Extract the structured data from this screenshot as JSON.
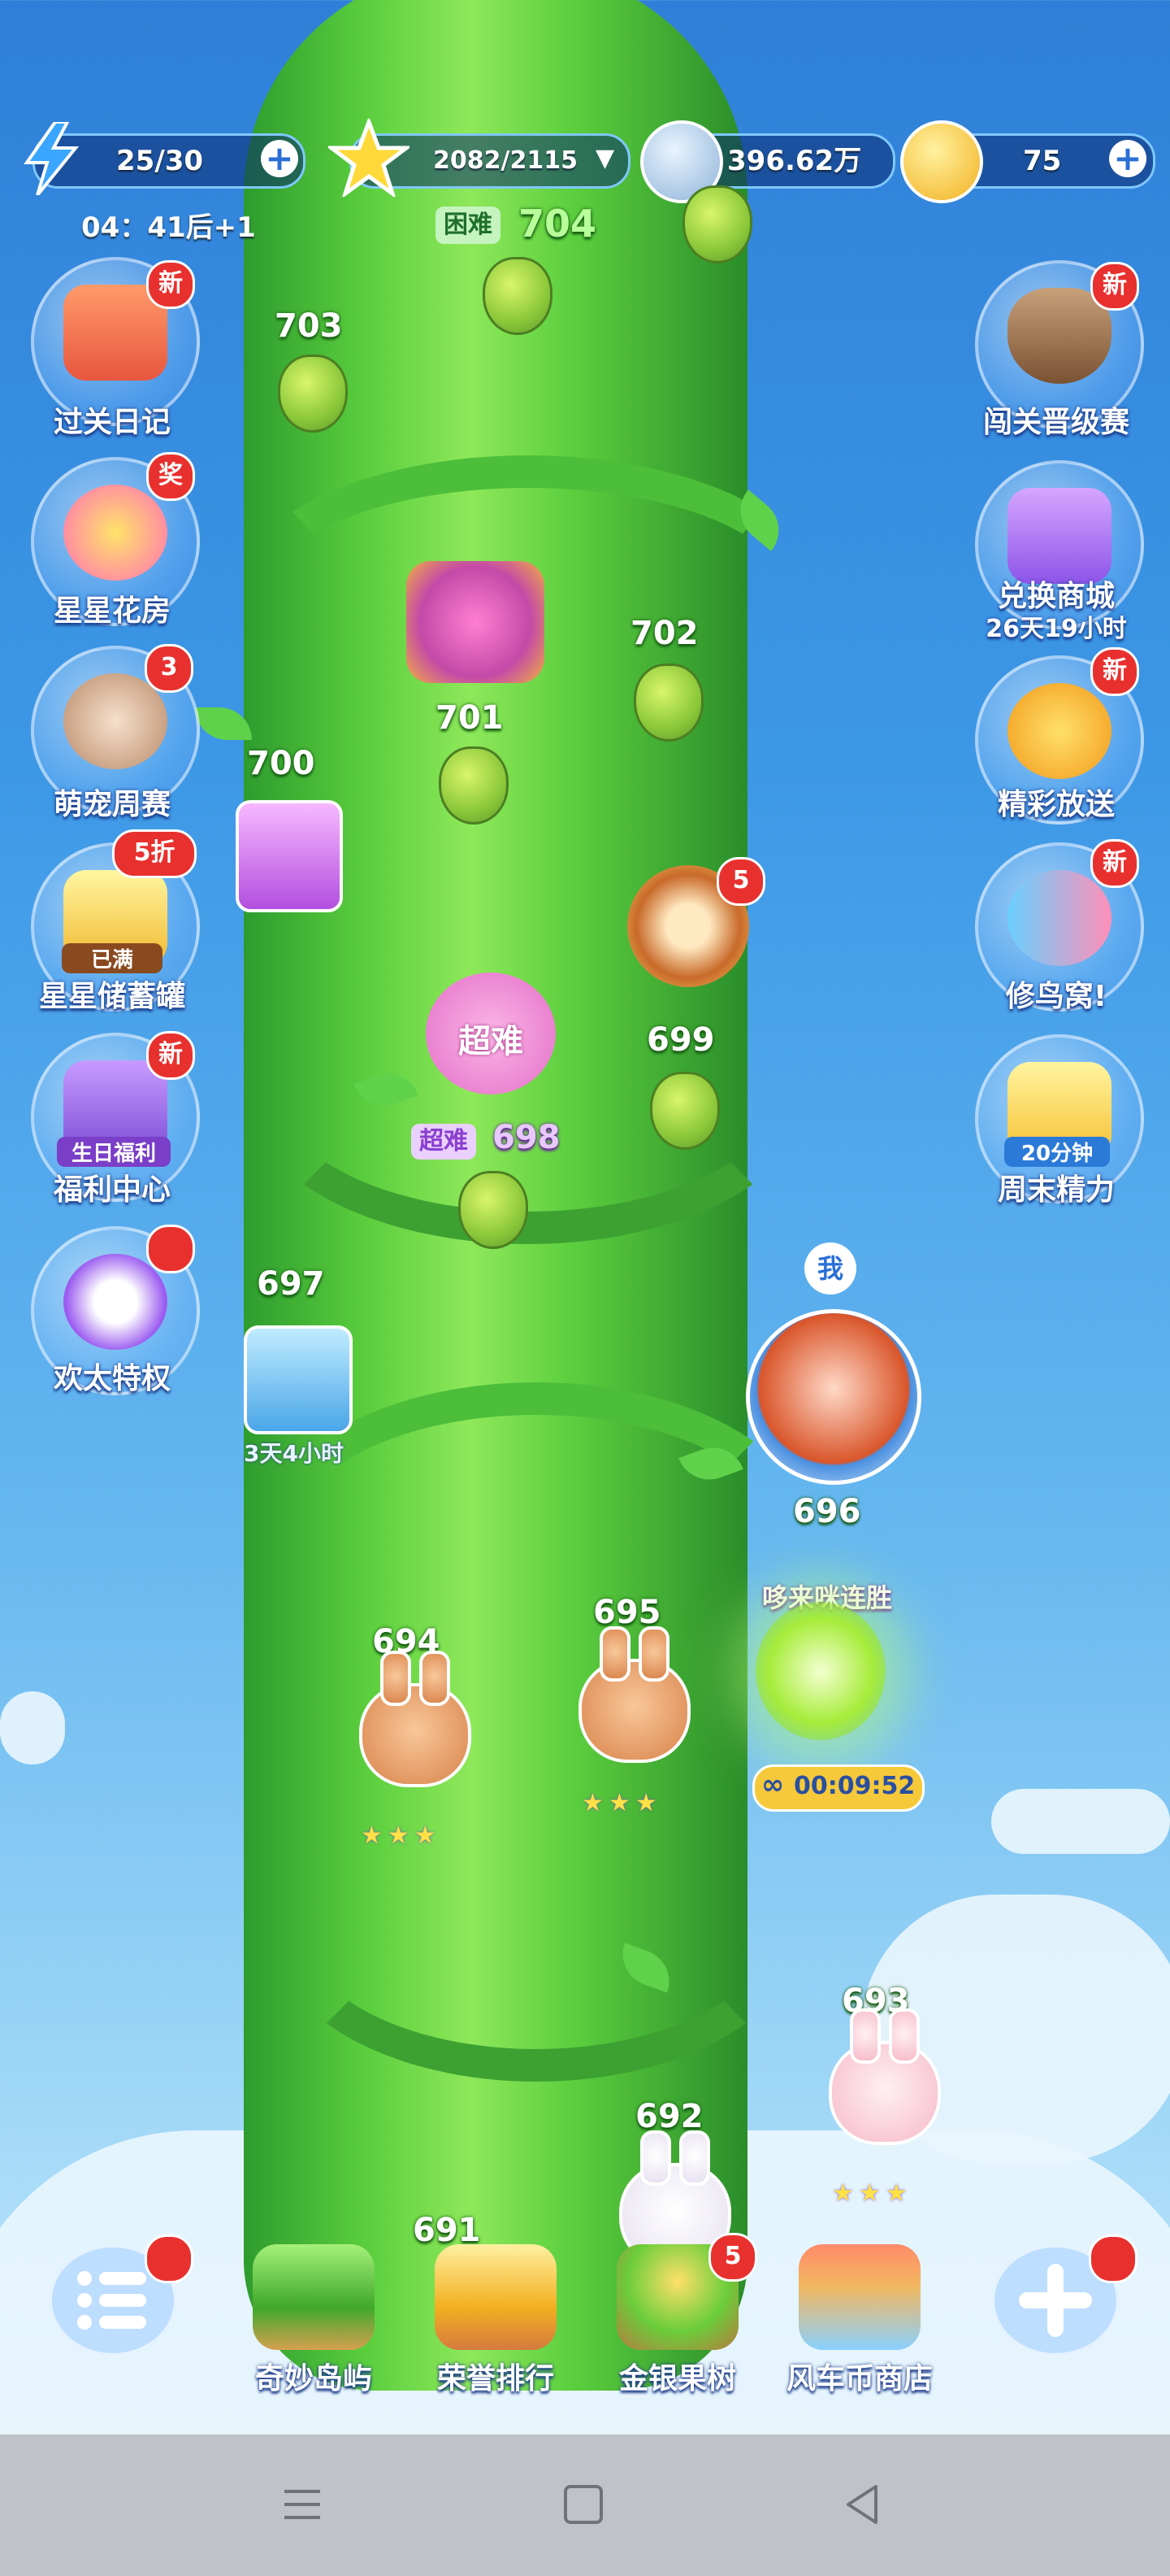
{
  "topbar": {
    "energy": "25/30",
    "energy_timer": "04：41后+1",
    "stars": "2082/2115",
    "coins_silver": "396.62万",
    "coins_gold": "75"
  },
  "current_level": {
    "tag": "困难",
    "number": "704"
  },
  "left_menu": [
    {
      "label": "过关日记",
      "badge": "新"
    },
    {
      "label": "星星花房",
      "badge": "奖"
    },
    {
      "label": "萌宠周赛",
      "badge": "3"
    },
    {
      "label": "星星储蓄罐",
      "badge": "5折",
      "sub": "已满"
    },
    {
      "label": "福利中心",
      "badge": "新",
      "sub": "生日福利"
    },
    {
      "label": "欢太特权",
      "badge": ""
    }
  ],
  "right_menu": [
    {
      "label": "闯关晋级赛",
      "badge": "新",
      "sub": ""
    },
    {
      "label": "兑换商城",
      "badge": "",
      "sub": "26天19小时"
    },
    {
      "label": "精彩放送",
      "badge": "新",
      "sub": ""
    },
    {
      "label": "修鸟窝!",
      "badge": "新",
      "sub": ""
    },
    {
      "label": "周末精力",
      "badge": "",
      "sub": "20分钟"
    }
  ],
  "levels": {
    "l703": "703",
    "l702": "702",
    "l701": "701",
    "l700": "700",
    "l699": "699",
    "l698": "698",
    "l698_tag": "超难",
    "flower_text": "超难",
    "l697": "697",
    "l697_timer": "3天4小时",
    "l696": "696",
    "l696_tag": "哆来咪连胜",
    "l696_timer": "00:09:52",
    "l695": "695",
    "l694": "694",
    "l693": "693",
    "l692": "692",
    "l691": "691",
    "me_label": "我",
    "star_rating": "★★★",
    "compass_badge": "5"
  },
  "bottom_bar": [
    {
      "label": "奇妙岛屿",
      "badge": ""
    },
    {
      "label": "荣誉排行",
      "badge": ""
    },
    {
      "label": "金银果树",
      "badge": "5"
    },
    {
      "label": "风车币商店",
      "badge": ""
    }
  ],
  "colors": {
    "accent_blue": "#2a6fd6",
    "badge_red": "#e8312f",
    "stalk_green": "#5ccf3e"
  }
}
